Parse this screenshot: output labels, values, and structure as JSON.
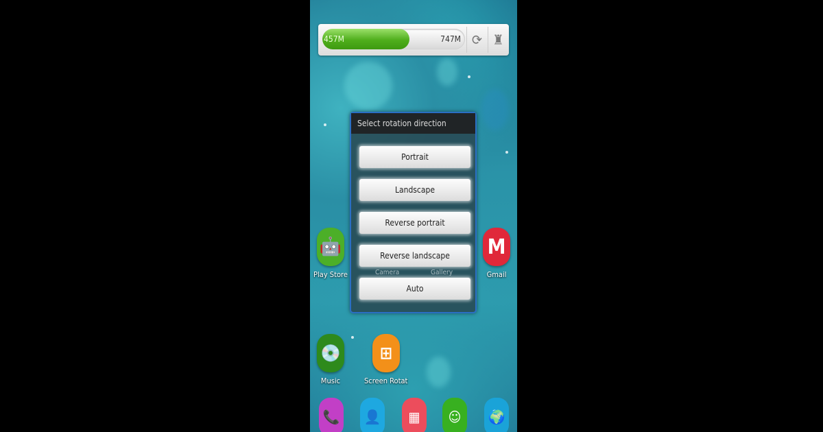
{
  "memory": {
    "used": "457M",
    "total": "747M",
    "used_fraction": 0.61,
    "refresh_icon": "refresh-icon",
    "clean_icon": "broom-icon"
  },
  "dialog": {
    "title": "Select rotation direction",
    "options": [
      "Portrait",
      "Landscape",
      "Reverse portrait",
      "Reverse landscape",
      "Auto"
    ]
  },
  "behind_labels": [
    "Camera",
    "Gallery"
  ],
  "apps": [
    {
      "label": "Play Store",
      "color": "#4caf28"
    },
    {
      "label": "Gmail",
      "color": "#e0283a"
    },
    {
      "label": "Music",
      "color": "#2e8a1c"
    },
    {
      "label": "Screen Rotation",
      "color": "#f39019"
    }
  ],
  "dock": [
    {
      "name": "phone",
      "color": "#c23fc6"
    },
    {
      "name": "contacts",
      "color": "#1ea8e0"
    },
    {
      "name": "apps",
      "color": "#ec4d5c"
    },
    {
      "name": "messaging",
      "color": "#38b020"
    },
    {
      "name": "browser",
      "color": "#1aa3d8"
    }
  ]
}
